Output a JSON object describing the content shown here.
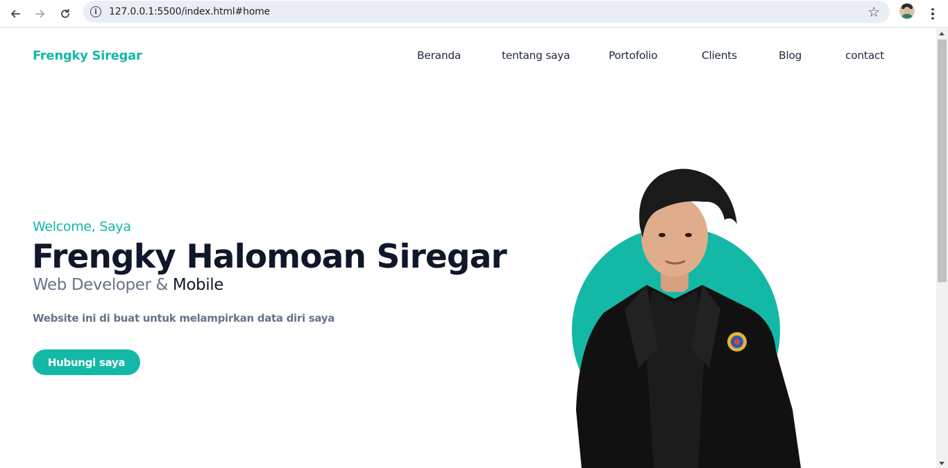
{
  "browser": {
    "url": "127.0.0.1:5500/index.html#home"
  },
  "site": {
    "brand": "Frengky Siregar",
    "nav": [
      "Beranda",
      "tentang saya",
      "Portofolio",
      "Clients",
      "Blog",
      "contact"
    ]
  },
  "hero": {
    "greeting": "Welcome, Saya",
    "name": "Frengky Halomoan Siregar",
    "role_prefix": "Web Developer & ",
    "role_highlight": "Mobile",
    "description": "Website ini di buat untuk melampirkan data diri saya",
    "cta_label": "Hubungi saya"
  },
  "colors": {
    "accent": "#14b8a6",
    "heading": "#0f172a",
    "muted": "#64748b"
  },
  "icons": [
    "back-arrow-icon",
    "forward-arrow-icon",
    "reload-icon",
    "info-icon",
    "star-icon",
    "profile-avatar",
    "menu-icon"
  ]
}
